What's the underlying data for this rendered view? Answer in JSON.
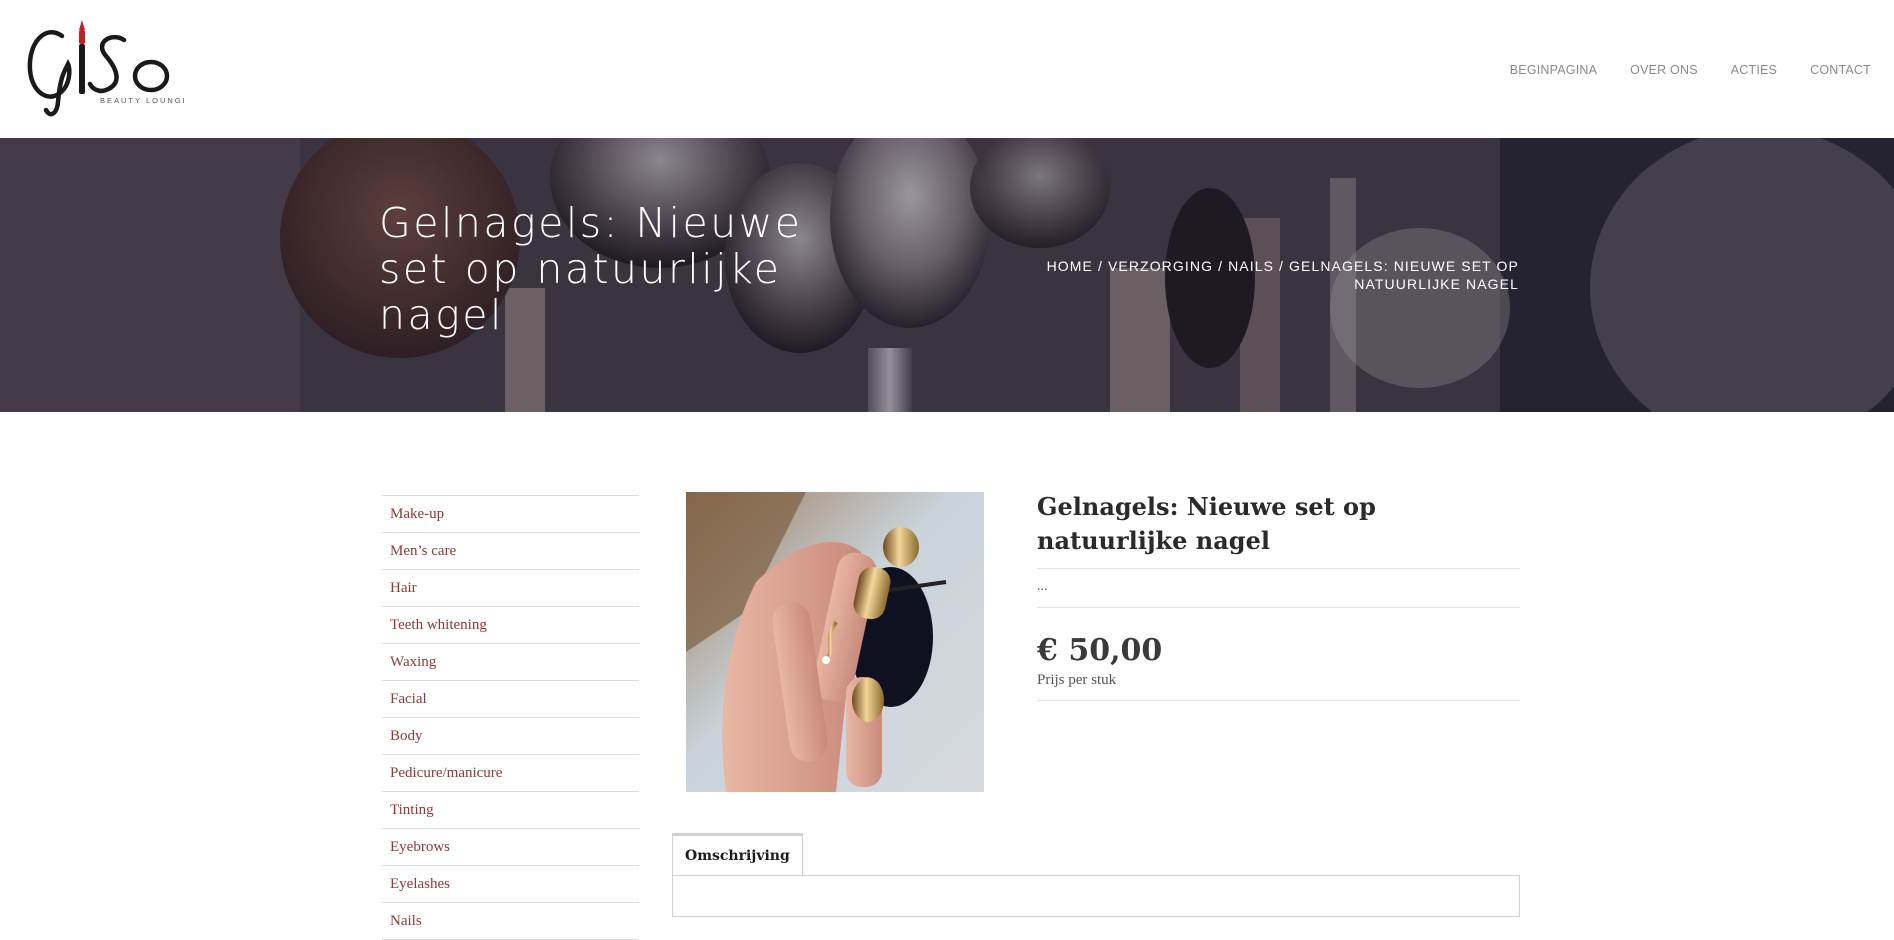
{
  "brand": {
    "logo_text": "GiSo",
    "logo_subtext": "BEAUTY LOUNGE",
    "accent_color": "#c0202a"
  },
  "nav": {
    "items": [
      {
        "label": "BEGINPAGINA"
      },
      {
        "label": "OVER ONS"
      },
      {
        "label": "ACTIES"
      },
      {
        "label": "CONTACT"
      }
    ]
  },
  "hero": {
    "title": "Gelnagels: Nieuwe set op natuurlijke nagel",
    "breadcrumb": {
      "home": "HOME",
      "sep": " / ",
      "level1": "VERZORGING",
      "level2": "NAILS",
      "current": "GELNAGELS: NIEUWE SET OP NATUURLIJKE NAGEL"
    }
  },
  "sidebar": {
    "categories": [
      {
        "label": "Make-up"
      },
      {
        "label": "Men’s care"
      },
      {
        "label": "Hair"
      },
      {
        "label": "Teeth whitening"
      },
      {
        "label": "Waxing"
      },
      {
        "label": "Facial"
      },
      {
        "label": "Body"
      },
      {
        "label": "Pedicure/manicure"
      },
      {
        "label": "Tinting"
      },
      {
        "label": "Eyebrows"
      },
      {
        "label": "Eyelashes"
      },
      {
        "label": "Nails"
      }
    ],
    "link_color": "#8b3a36"
  },
  "product": {
    "title": "Gelnagels: Nieuwe set op natuurlijke nagel",
    "short_description": "...",
    "price": "€ 50,00",
    "price_unit": "Prijs per stuk"
  },
  "tabs": {
    "items": [
      {
        "label": "Omschrijving"
      }
    ]
  }
}
